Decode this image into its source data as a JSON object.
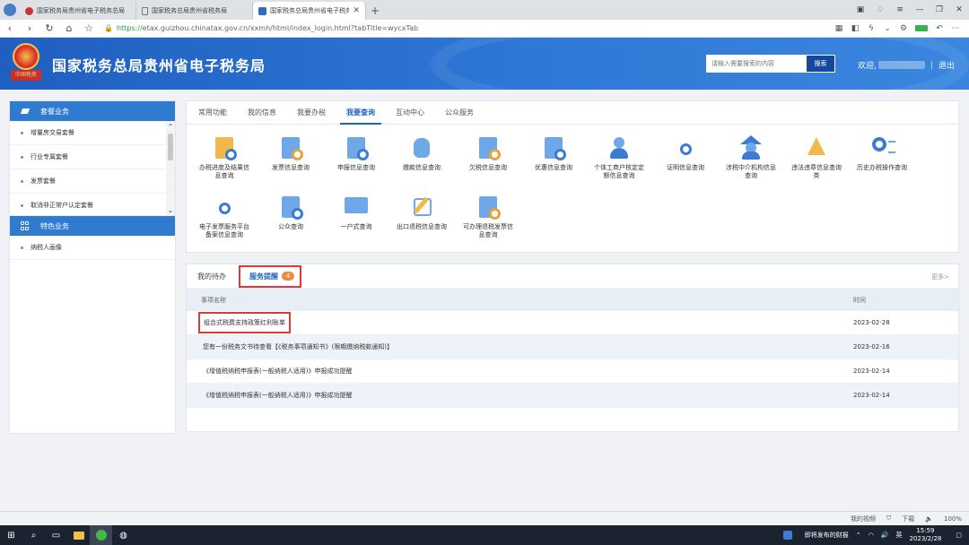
{
  "browser": {
    "tabs": [
      {
        "title": "国家税务局贵州省电子税务总局",
        "active": false
      },
      {
        "title": "国家税务总局贵州省税务局",
        "active": false
      },
      {
        "title": "国家税务总局贵州省电子税务局",
        "active": true
      }
    ],
    "url_proto": "https://",
    "url_rest": "etax.guizhou.chinatax.gov.cn/xxmh/html/index_login.html?tabTitle=wycxTab"
  },
  "header": {
    "site_title": "国家税务总局贵州省电子税务局",
    "emblem_text": "中国税务",
    "search_placeholder": "请输入需要搜索的内容",
    "search_button": "搜索",
    "welcome": "欢迎,",
    "logout": "退出"
  },
  "sidebar": {
    "section1_title": "套餐业务",
    "section1_items": [
      "增量房交易套餐",
      "行业专属套餐",
      "发票套餐",
      "取消非正常户认定套餐"
    ],
    "section2_title": "特色业务",
    "section2_items": [
      "纳税人画像"
    ]
  },
  "main_tabs": [
    "常用功能",
    "我的信息",
    "我要办税",
    "我要查询",
    "互动中心",
    "公众服务"
  ],
  "active_tab_index": 3,
  "query_items": [
    {
      "label": "办税进度及结果信息查询",
      "icon": "edit-doc-icon"
    },
    {
      "label": "发票信息查询",
      "icon": "invoice-search-icon"
    },
    {
      "label": "申报信息查询",
      "icon": "declare-search-icon"
    },
    {
      "label": "缴款信息查询",
      "icon": "money-bag-icon"
    },
    {
      "label": "欠税信息查询",
      "icon": "arrears-search-icon"
    },
    {
      "label": "优惠信息查询",
      "icon": "discount-search-icon"
    },
    {
      "label": "个体工商户核定定额信息查询",
      "icon": "person-search-icon"
    },
    {
      "label": "证明信息查询",
      "icon": "certificate-search-icon"
    },
    {
      "label": "涉税中介机构信息查询",
      "icon": "agency-icon"
    },
    {
      "label": "违法违章信息查询类",
      "icon": "warning-icon"
    },
    {
      "label": "历史办税操作查询",
      "icon": "history-search-icon"
    },
    {
      "label": "电子发票服务平台备案信息查询",
      "icon": "einvoice-search-icon"
    },
    {
      "label": "公众查询",
      "icon": "public-search-icon"
    },
    {
      "label": "一户式查询",
      "icon": "monitor-icon"
    },
    {
      "label": "出口退税信息查询",
      "icon": "export-refund-icon"
    },
    {
      "label": "可办理退税发票信息查询",
      "icon": "refund-invoice-icon"
    }
  ],
  "reminder": {
    "tabs": [
      "我的待办",
      "服务提醒"
    ],
    "badge_count": "4",
    "more": "更多>",
    "columns": [
      "事项名称",
      "时间"
    ],
    "rows": [
      {
        "name": "组合式税费支持政策红利账单",
        "date": "2023-02-28"
      },
      {
        "name": "您有一份税务文书待查看【《税务事项通知书》(限期缴纳税款通知)】",
        "date": "2023-02-16"
      },
      {
        "name": "《增值税纳税申报表(一般纳税人适用)》申报成功提醒",
        "date": "2023-02-14"
      },
      {
        "name": "《增值税纳税申报表(一般纳税人适用)》申报成功提醒",
        "date": "2023-02-14"
      }
    ]
  },
  "statusbar": {
    "video": "我的视频",
    "download": "下载",
    "zoom": "100%"
  },
  "taskbar": {
    "news": "即将发布的财报",
    "lang": "英",
    "time": "15:59",
    "date": "2023/2/28"
  }
}
